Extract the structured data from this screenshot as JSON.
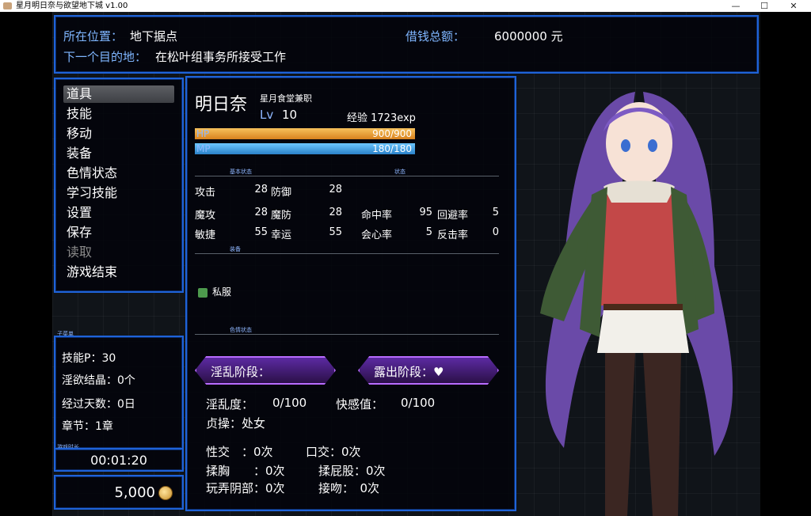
{
  "window": {
    "title": "星月明日奈与欲望地下城 v1.00",
    "controls": [
      "—",
      "☐",
      "✕"
    ]
  },
  "location": {
    "label": "所在位置：",
    "value": "地下据点"
  },
  "next_destination": {
    "label": "下一个目的地：",
    "value": "在松叶组事务所接受工作"
  },
  "debt": {
    "label": "借钱总额：",
    "value": "6000000 元"
  },
  "menu": {
    "items": [
      {
        "label": "道具",
        "selected": true,
        "enabled": true
      },
      {
        "label": "技能",
        "selected": false,
        "enabled": true
      },
      {
        "label": "移动",
        "selected": false,
        "enabled": true
      },
      {
        "label": "装备",
        "selected": false,
        "enabled": true
      },
      {
        "label": "色情状态",
        "selected": false,
        "enabled": true
      },
      {
        "label": "学习技能",
        "selected": false,
        "enabled": true
      },
      {
        "label": "设置",
        "selected": false,
        "enabled": true
      },
      {
        "label": "保存",
        "selected": false,
        "enabled": true
      },
      {
        "label": "读取",
        "selected": false,
        "enabled": false
      },
      {
        "label": "游戏结束",
        "selected": false,
        "enabled": true
      }
    ]
  },
  "submenu": {
    "tag": "子菜单",
    "skill_points": "技能P：30",
    "crystals": "淫欲结晶：0个",
    "days": "经过天数：0日",
    "chapter": "章节：1章"
  },
  "playtime": {
    "tag": "游戏时长",
    "value": "00:01:20"
  },
  "gold": {
    "value": "5,000"
  },
  "character": {
    "name": "明日奈",
    "job": "星月食堂兼职",
    "lv_label": "Lv",
    "lv": "10",
    "exp": "经验 1723exp",
    "hp": {
      "label": "HP",
      "value": "900/900",
      "current": 900,
      "max": 900,
      "color": "#f0a33a"
    },
    "mp": {
      "label": "MP",
      "value": "180/180",
      "current": 180,
      "max": 180,
      "color": "#3ea4e6"
    },
    "basic_tag": "基本状态",
    "state_tag": "状态",
    "stats": {
      "atk": {
        "label": "攻击",
        "value": "28"
      },
      "def": {
        "label": "防御",
        "value": "28"
      },
      "mat": {
        "label": "魔攻",
        "value": "28"
      },
      "mdf": {
        "label": "魔防",
        "value": "28"
      },
      "agi": {
        "label": "敏捷",
        "value": "55"
      },
      "luk": {
        "label": "幸运",
        "value": "55"
      },
      "hit": {
        "label": "命中率",
        "value": "95"
      },
      "eva": {
        "label": "回避率",
        "value": "5"
      },
      "cri": {
        "label": "会心率",
        "value": "5"
      },
      "cnt": {
        "label": "反击率",
        "value": "0"
      }
    },
    "equip_tag": "装备",
    "equipment": "私服",
    "lewd_tag": "色情状态",
    "lewd_stage": "淫乱阶段：",
    "exposure_stage": "露出阶段：♥",
    "lewdness": {
      "label": "淫乱度：",
      "value": "0/100"
    },
    "pleasure": {
      "label": "快感值：",
      "value": "0/100"
    },
    "chastity": "贞操：处女",
    "records": {
      "sex": "性交　：0次",
      "oral": "口交：0次",
      "breast": "揉胸　　：0次",
      "butt": "揉屁股：0次",
      "genital": "玩弄阴部：0次",
      "kiss": "接吻：　0次"
    }
  },
  "colors": {
    "panel_border": "#1f63d8",
    "label_blue": "#8fb7ff",
    "badge_purple": "#b86cff"
  }
}
